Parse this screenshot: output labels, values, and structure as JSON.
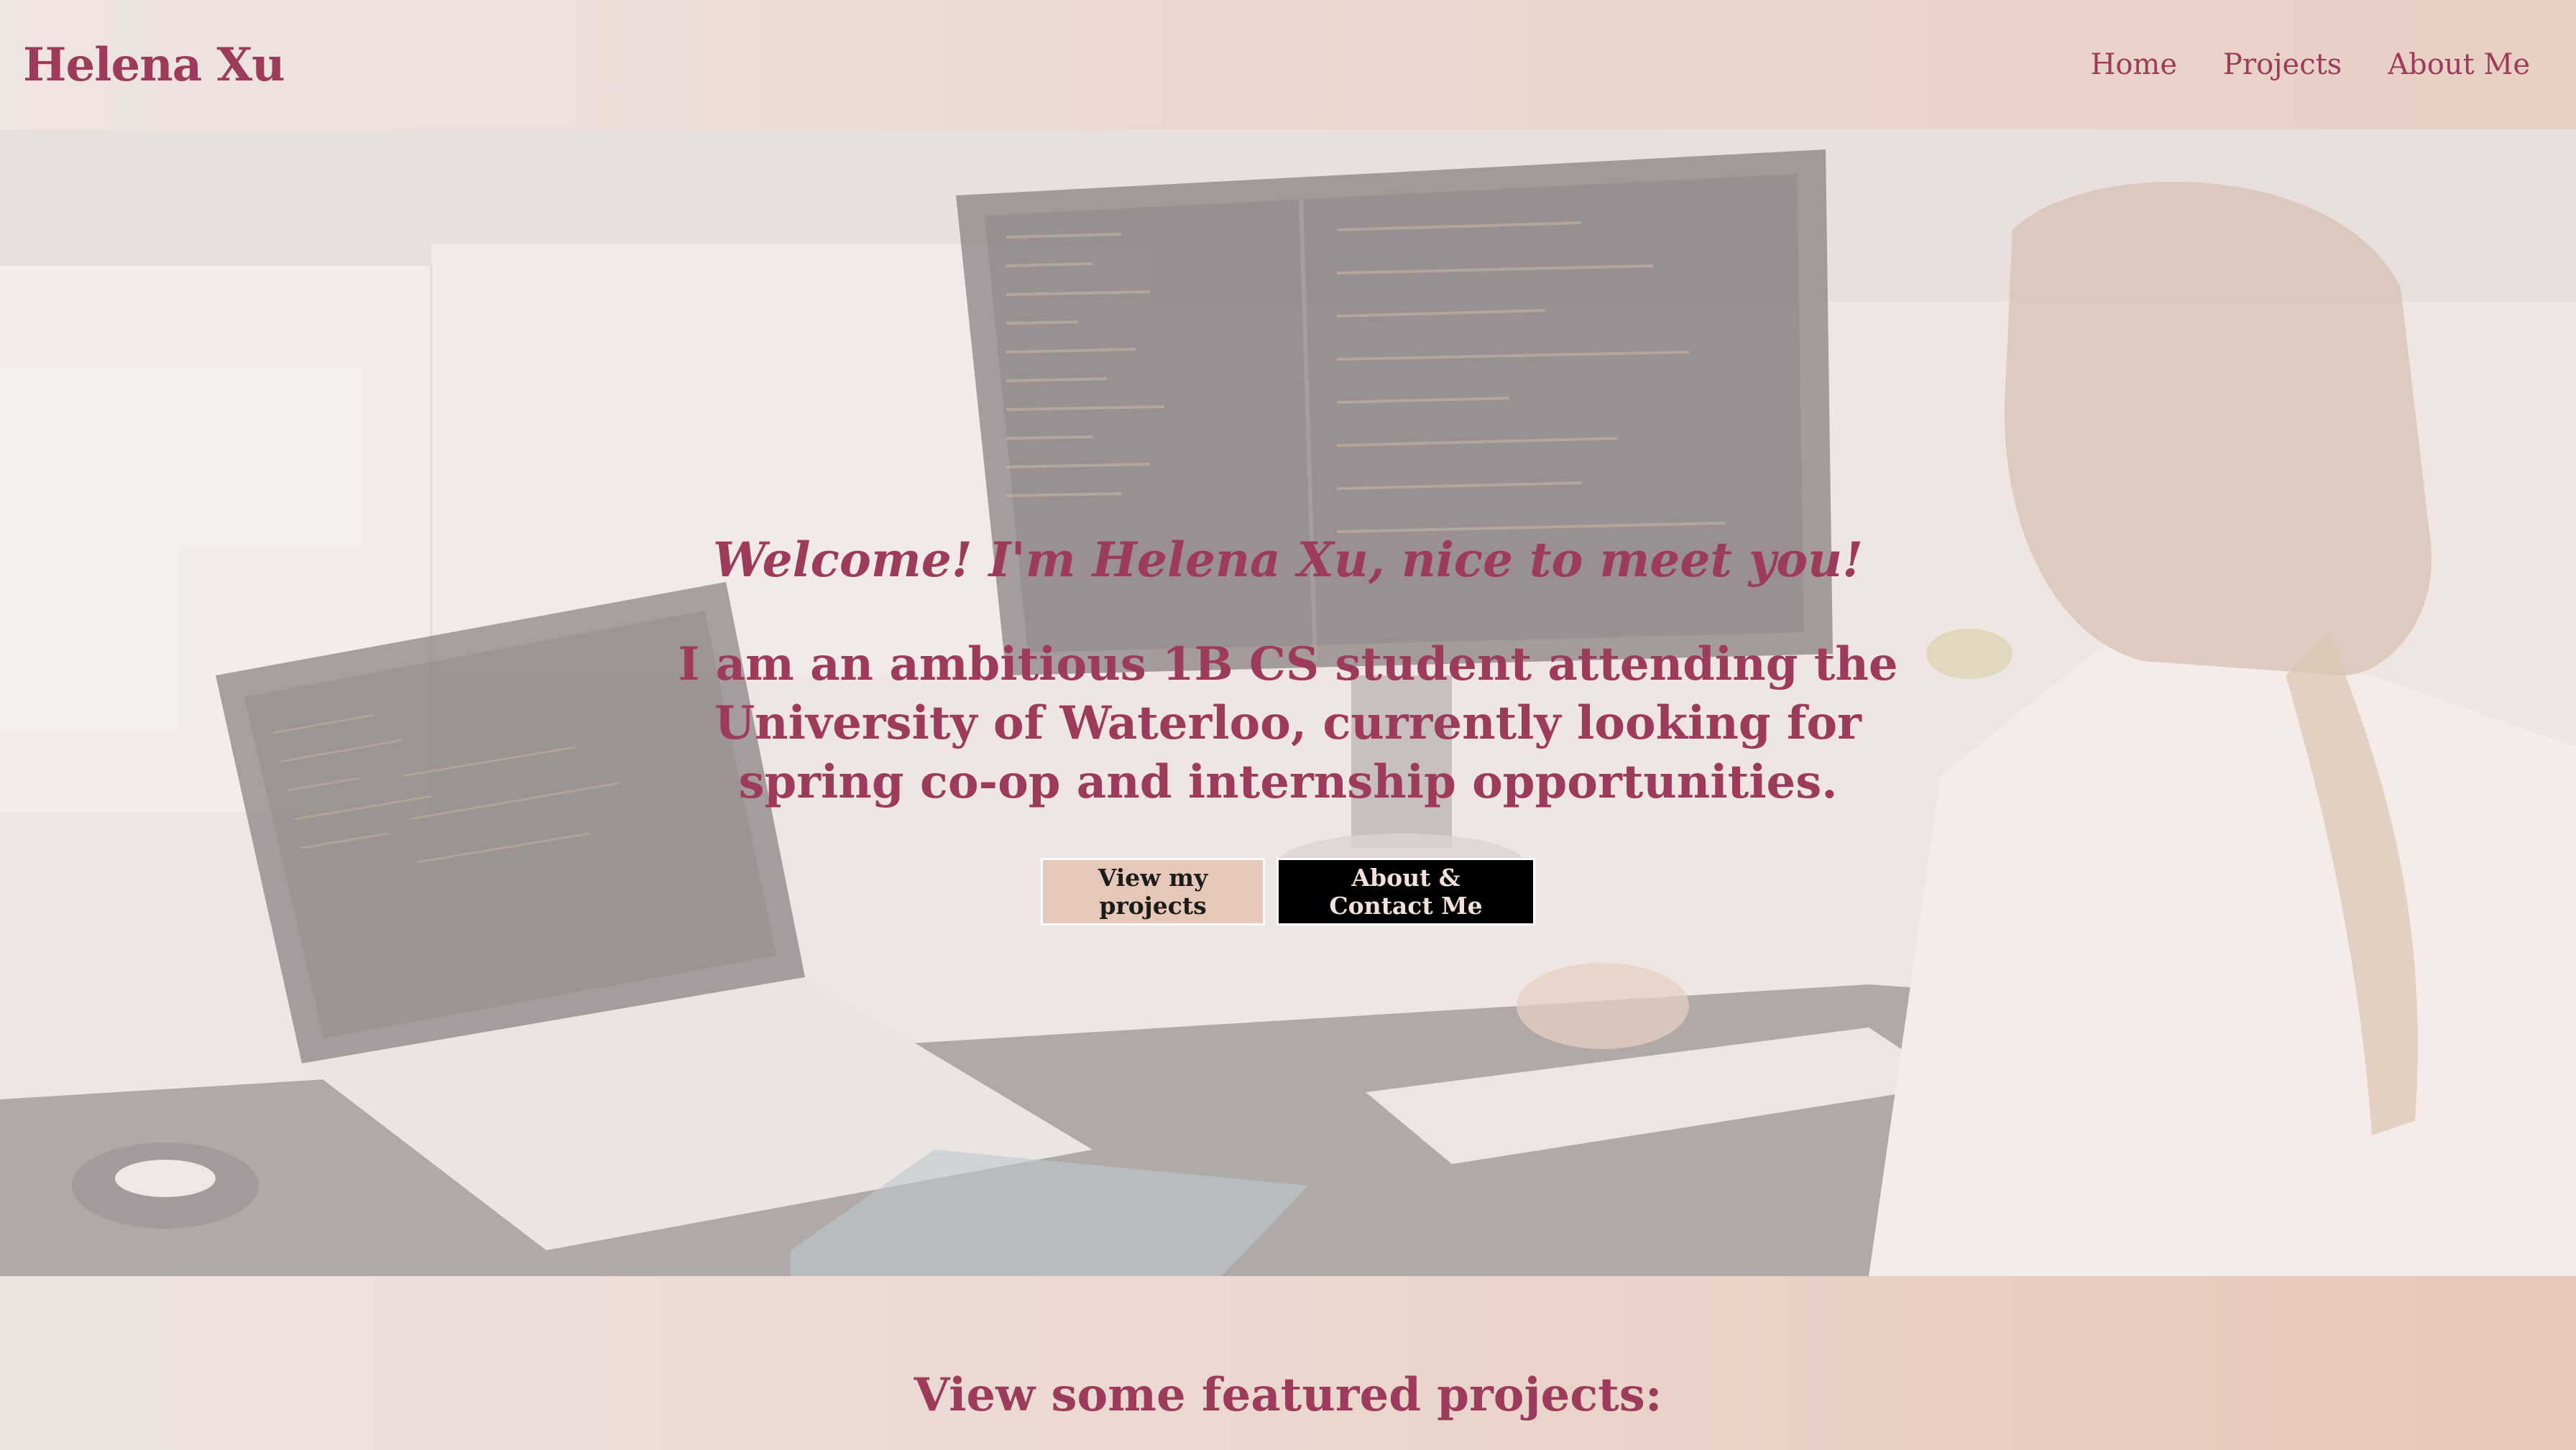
{
  "header": {
    "brand": "Helena Xu",
    "nav": [
      "Home",
      "Projects",
      "About Me"
    ]
  },
  "hero": {
    "welcome": "Welcome! I'm Helena Xu, nice to meet you!",
    "intro": "I am an ambitious 1B CS student attending the University of Waterloo, currently looking for spring co-op and internship opportunities.",
    "buttons": {
      "projects": "View my projects",
      "contact": "About & Contact Me"
    }
  },
  "featured": {
    "title": "View some featured projects:"
  },
  "colors": {
    "accent": "#9c3b5c",
    "button_light": "#e6c7b8",
    "button_dark": "#000000"
  }
}
